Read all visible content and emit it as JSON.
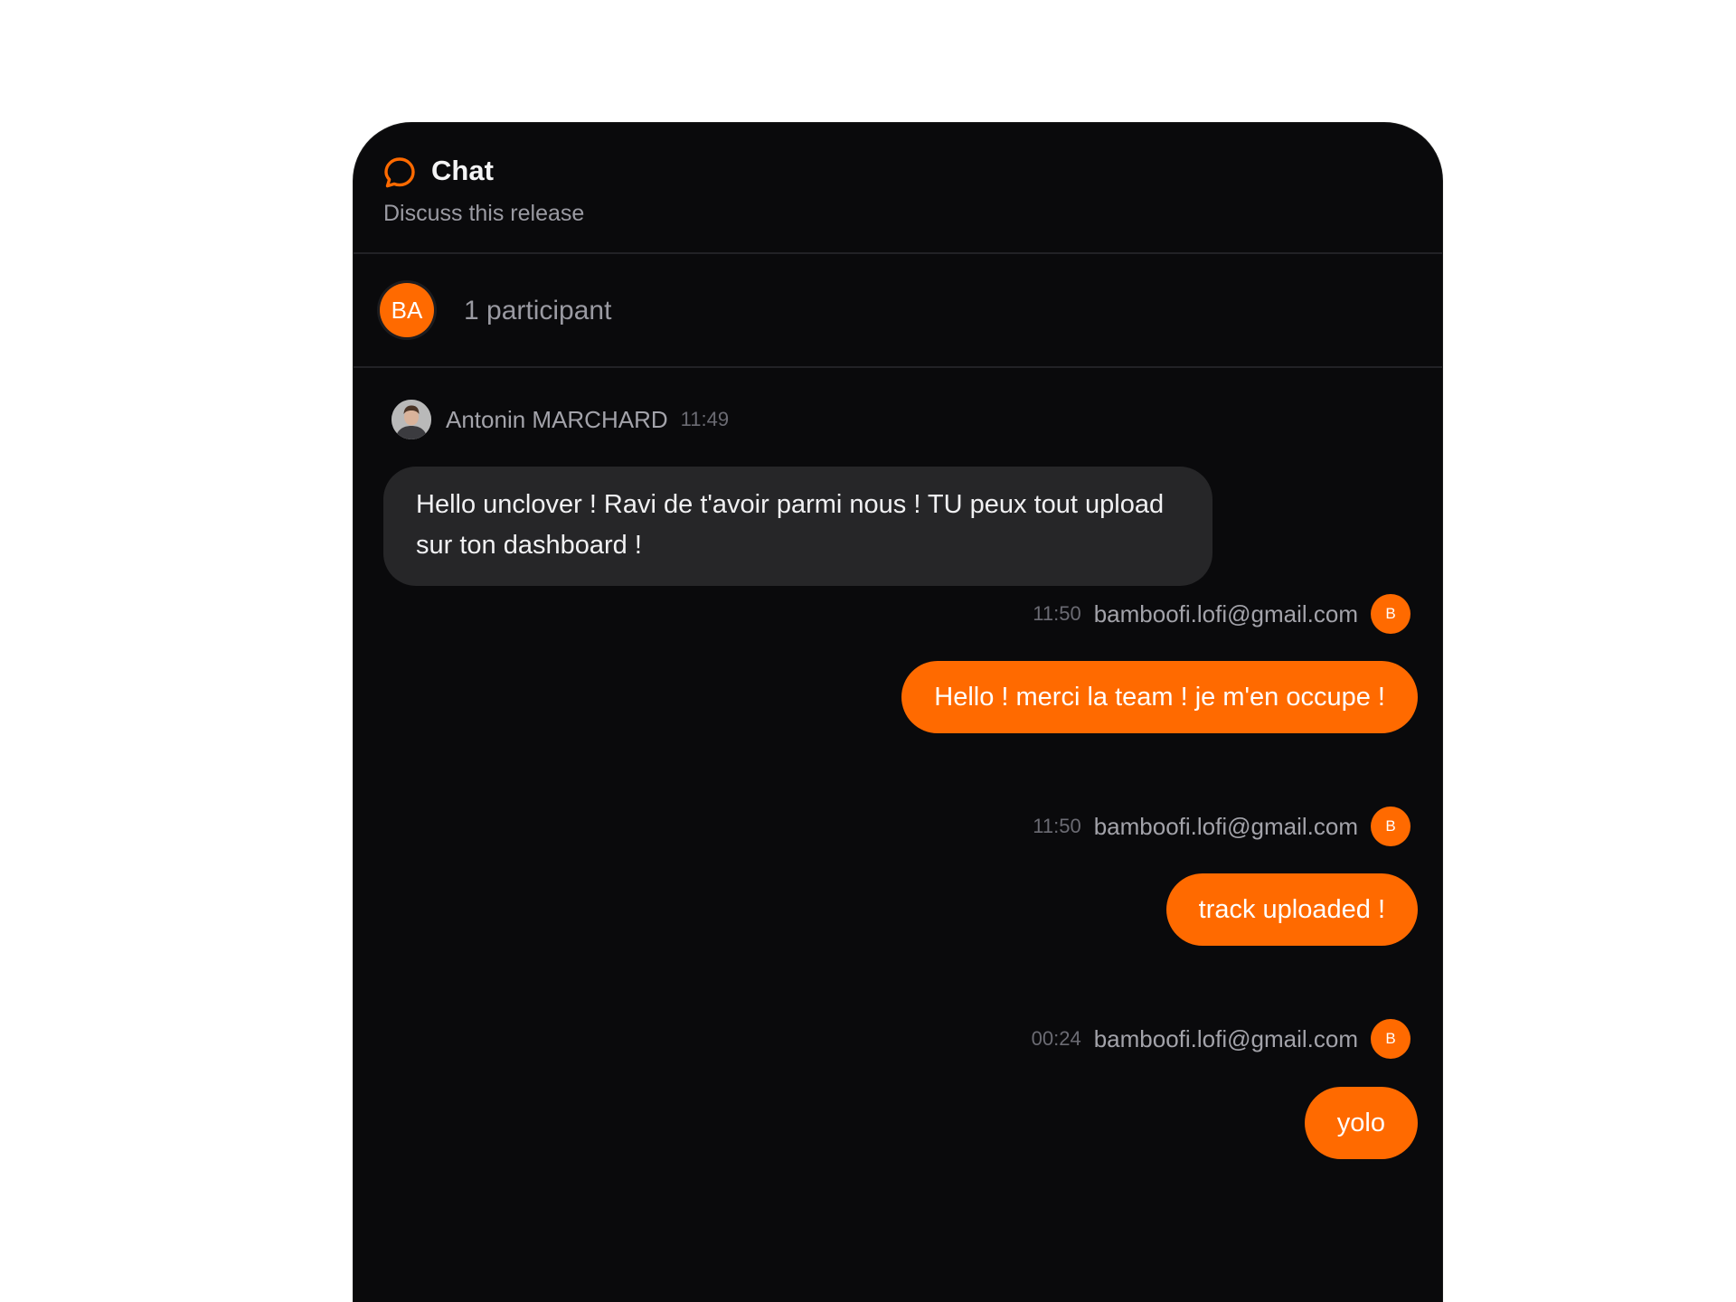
{
  "header": {
    "title": "Chat",
    "subtitle": "Discuss this release",
    "icon": "chat-bubble-icon"
  },
  "participants": {
    "avatar_initials": "BA",
    "count_label": "1 participant"
  },
  "messages": [
    {
      "author": "Antonin MARCHARD",
      "time": "11:49",
      "text": "Hello unclover ! Ravi de t'avoir parmi nous ! TU peux tout upload sur ton dashboard !",
      "side": "left"
    },
    {
      "author": "bamboofi.lofi@gmail.com",
      "time": "11:50",
      "avatar": "B",
      "text": "Hello ! merci la team ! je m'en occupe !",
      "side": "right"
    },
    {
      "author": "bamboofi.lofi@gmail.com",
      "time": "11:50",
      "avatar": "B",
      "text": "track uploaded !",
      "side": "right"
    },
    {
      "author": "bamboofi.lofi@gmail.com",
      "time": "00:24",
      "avatar": "B",
      "text": "yolo",
      "side": "right"
    }
  ],
  "colors": {
    "accent": "#ff6a00",
    "panel": "#0a0a0c",
    "incoming_bubble": "#262628"
  }
}
